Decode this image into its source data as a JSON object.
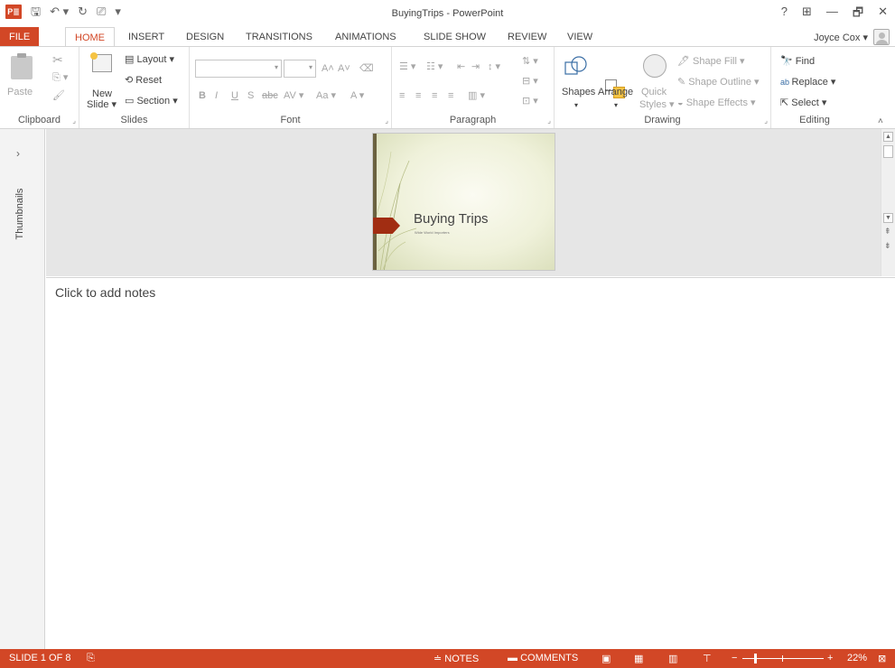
{
  "titlebar": {
    "app_icon": "P≣",
    "title": "BuyingTrips - PowerPoint",
    "qat": [
      "save-icon",
      "undo-icon",
      "redo-icon",
      "start-from-beginning-icon",
      "customize-qat-icon"
    ],
    "controls": [
      "?",
      "⊞",
      "—",
      "🗗",
      "✕"
    ]
  },
  "tabs": [
    {
      "label": "FILE"
    },
    {
      "label": "HOME"
    },
    {
      "label": "INSERT"
    },
    {
      "label": "DESIGN"
    },
    {
      "label": "TRANSITIONS"
    },
    {
      "label": "ANIMATIONS"
    },
    {
      "label": "SLIDE SHOW"
    },
    {
      "label": "REVIEW"
    },
    {
      "label": "VIEW"
    }
  ],
  "user": {
    "name": "Joyce Cox ▾"
  },
  "ribbon": {
    "clipboard": {
      "label": "Clipboard",
      "paste": "Paste"
    },
    "slides": {
      "label": "Slides",
      "new_slide": "New",
      "new_slide2": "Slide ▾",
      "layout": "Layout ▾",
      "reset": "Reset",
      "section": "Section ▾"
    },
    "font": {
      "label": "Font",
      "bold": "B",
      "italic": "I",
      "underline": "U",
      "shadow": "S",
      "strike": "abc",
      "spacing": "AV ▾",
      "case": "Aa ▾",
      "color": "A ▾",
      "grow": "A˄",
      "shrink": "A˅"
    },
    "paragraph": {
      "label": "Paragraph"
    },
    "drawing": {
      "label": "Drawing",
      "shapes": "Shapes",
      "arrange": "Arrange",
      "quick": "Quick",
      "quick2": "Styles ▾",
      "fill": "Shape Fill ▾",
      "outline": "Shape Outline ▾",
      "effects": "Shape Effects ▾"
    },
    "editing": {
      "label": "Editing",
      "find": "Find",
      "replace": "Replace ▾",
      "select": "Select ▾"
    }
  },
  "thumbnails": {
    "label": "Thumbnails",
    "expand": "›"
  },
  "slide": {
    "title": "Buying Trips",
    "subtitle": "Wide World Importers"
  },
  "notes": {
    "placeholder": "Click to add notes"
  },
  "status": {
    "slide_info": "SLIDE 1 OF 8",
    "notes": "≐ NOTES",
    "comments": "COMMENTS",
    "zoom": "22%",
    "zoom_value": 22
  },
  "colors": {
    "accent": "#D24726",
    "slide_tag": "#A12D12"
  }
}
